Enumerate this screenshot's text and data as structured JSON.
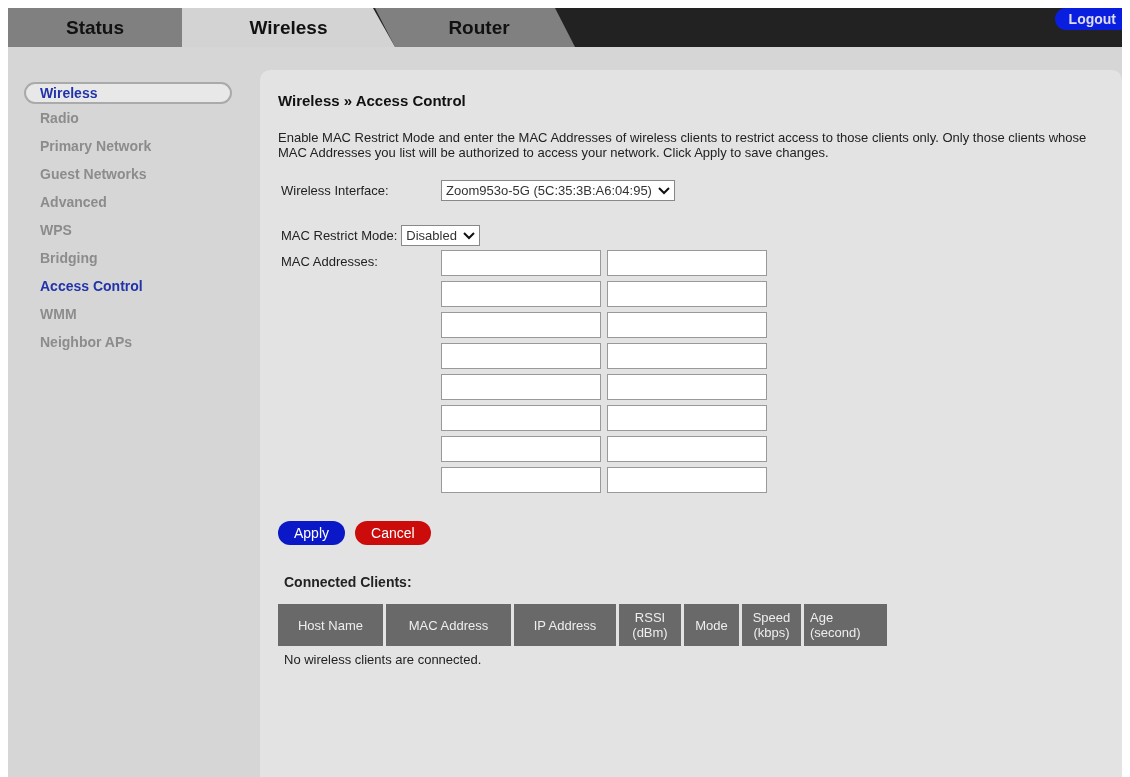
{
  "tabs": [
    {
      "label": "Status",
      "selected": false
    },
    {
      "label": "Wireless",
      "selected": true
    },
    {
      "label": "Router",
      "selected": false
    }
  ],
  "logout": "Logout",
  "sidebar": {
    "heading": "Wireless",
    "items": [
      {
        "label": "Radio",
        "selected": false
      },
      {
        "label": "Primary Network",
        "selected": false
      },
      {
        "label": "Guest Networks",
        "selected": false
      },
      {
        "label": "Advanced",
        "selected": false
      },
      {
        "label": "WPS",
        "selected": false
      },
      {
        "label": "Bridging",
        "selected": false
      },
      {
        "label": "Access Control",
        "selected": true
      },
      {
        "label": "WMM",
        "selected": false
      },
      {
        "label": "Neighbor APs",
        "selected": false
      }
    ]
  },
  "title": "Wireless » Access Control",
  "description": "Enable MAC Restrict Mode and enter the MAC Addresses of wireless clients to restrict access to those clients only. Only those clients whose MAC Addresses you list will be authorized to access your network. Click Apply to save changes.",
  "wireless_interface": {
    "label": "Wireless Interface:",
    "value": "Zoom953o-5G (5C:35:3B:A6:04:95)"
  },
  "mac_restrict_mode": {
    "label": "MAC Restrict Mode:",
    "value": "Disabled"
  },
  "mac_addresses": {
    "label": "MAC Addresses:",
    "rows": [
      {
        "kind": "pair"
      },
      {
        "kind": "pair"
      },
      {
        "kind": "pair"
      },
      {
        "kind": "pair"
      },
      {
        "kind": "pair"
      },
      {
        "kind": "pair"
      },
      {
        "kind": "pair"
      },
      {
        "kind": "pair"
      }
    ]
  },
  "buttons": [
    {
      "label": "Apply",
      "kind": "primary"
    },
    {
      "label": "Cancel",
      "kind": "danger"
    }
  ],
  "connected_clients": {
    "title": "Connected Clients:",
    "columns": [
      [
        "Host Name"
      ],
      [
        "MAC Address"
      ],
      [
        "IP Address"
      ],
      [
        "RSSI",
        "(dBm)"
      ],
      [
        "Mode"
      ],
      [
        "Speed",
        "(kbps)"
      ],
      [
        "Age",
        "(second)"
      ]
    ],
    "empty_message": "No wireless clients are connected."
  }
}
